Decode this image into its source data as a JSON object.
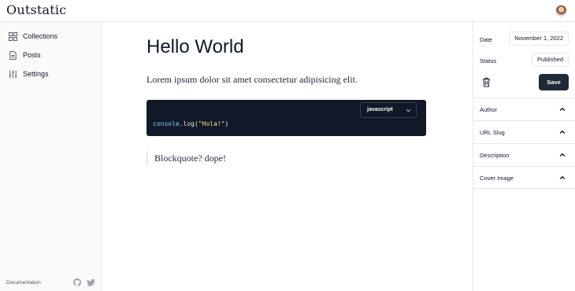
{
  "app": {
    "logo": "Outstatic"
  },
  "sidebar": {
    "items": [
      {
        "label": "Collections",
        "icon": "grid-icon"
      },
      {
        "label": "Posts",
        "icon": "document-icon"
      },
      {
        "label": "Settings",
        "icon": "sliders-icon"
      }
    ],
    "footer": {
      "documentation": "Documentation"
    }
  },
  "editor": {
    "title": "Hello World",
    "paragraph": "Lorem ipsum dolor sit amet consectetur adipisicing elit.",
    "code_block": {
      "language": "javascript",
      "code_object": "console",
      "code_method": ".log(",
      "code_string": "\"Hola!\"",
      "code_close": ")"
    },
    "blockquote": "Blockquote? dope!"
  },
  "panel": {
    "date_label": "Date",
    "date_value": "November 1, 2022",
    "status_label": "Status",
    "status_value": "Published",
    "save_label": "Save",
    "sections": [
      "Author",
      "URL Slug",
      "Description",
      "Cover Image"
    ]
  }
}
